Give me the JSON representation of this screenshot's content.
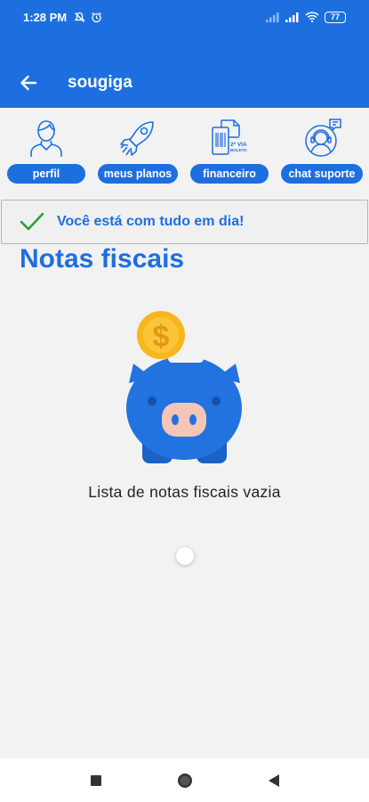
{
  "status_bar": {
    "time": "1:28 PM",
    "battery": "77"
  },
  "toolbar": {
    "title": "sougiga"
  },
  "quick_menu": [
    {
      "label": "perfil",
      "icon": "user-icon"
    },
    {
      "label": "meus planos",
      "icon": "rocket-icon"
    },
    {
      "label": "financeiro",
      "icon": "invoice-icon",
      "icon_text": "2ª VIA BOLETO"
    },
    {
      "label": "chat suporte",
      "icon": "support-chat-icon"
    }
  ],
  "banner": {
    "text": "Você está com tudo em dia!",
    "icon": "check-icon"
  },
  "page": {
    "title": "Notas fiscais",
    "empty_text": "Lista de notas fiscais vazia"
  },
  "colors": {
    "primary": "#1d6fe0",
    "coin": "#f6b61c",
    "check": "#2e9e3a",
    "piggy": "#2272e0",
    "snout": "#f4c6b7"
  }
}
